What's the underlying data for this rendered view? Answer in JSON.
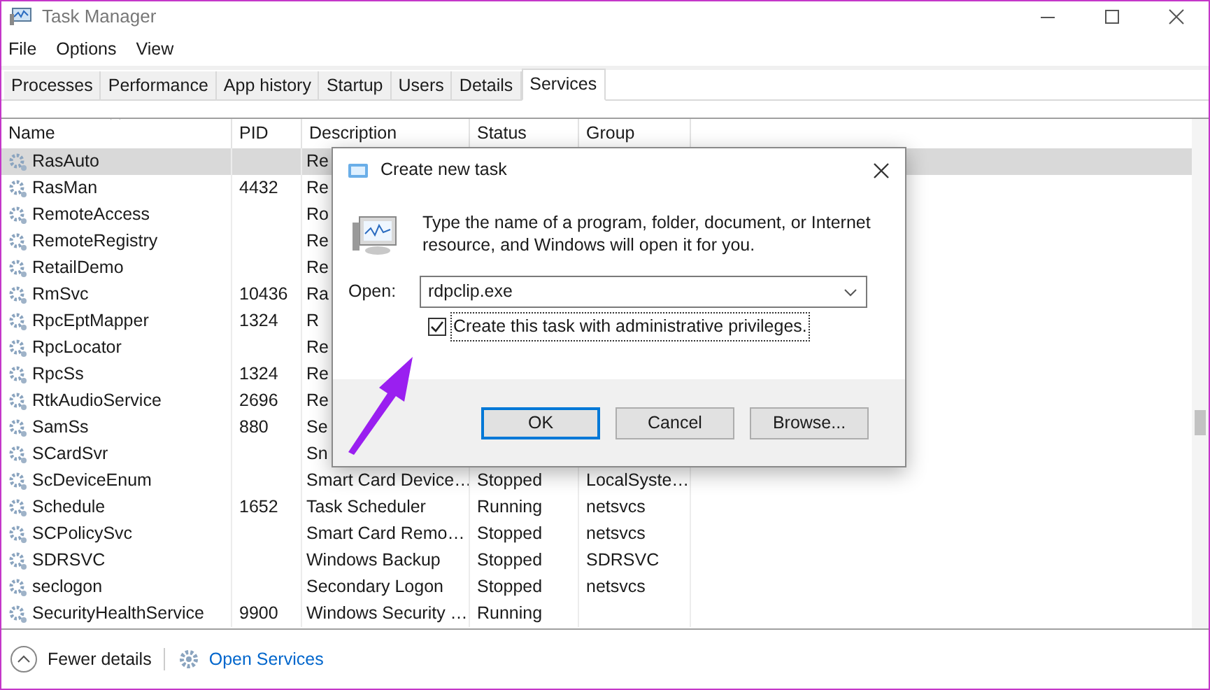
{
  "window": {
    "title": "Task Manager"
  },
  "menu": [
    "File",
    "Options",
    "View"
  ],
  "tabs": [
    {
      "label": "Processes",
      "selected": false
    },
    {
      "label": "Performance",
      "selected": false
    },
    {
      "label": "App history",
      "selected": false
    },
    {
      "label": "Startup",
      "selected": false
    },
    {
      "label": "Users",
      "selected": false
    },
    {
      "label": "Details",
      "selected": false
    },
    {
      "label": "Services",
      "selected": true
    }
  ],
  "table": {
    "columns": [
      "Name",
      "PID",
      "Description",
      "Status",
      "Group"
    ],
    "rows": [
      {
        "name": "RasAuto",
        "pid": "",
        "description": "Re",
        "status": "",
        "group": "",
        "selected": true
      },
      {
        "name": "RasMan",
        "pid": "4432",
        "description": "Re",
        "status": "",
        "group": "",
        "selected": false
      },
      {
        "name": "RemoteAccess",
        "pid": "",
        "description": "Ro",
        "status": "",
        "group": "",
        "selected": false
      },
      {
        "name": "RemoteRegistry",
        "pid": "",
        "description": "Re",
        "status": "",
        "group": "",
        "selected": false
      },
      {
        "name": "RetailDemo",
        "pid": "",
        "description": "Re",
        "status": "",
        "group": "",
        "selected": false
      },
      {
        "name": "RmSvc",
        "pid": "10436",
        "description": "Ra",
        "status": "",
        "group": "",
        "selected": false
      },
      {
        "name": "RpcEptMapper",
        "pid": "1324",
        "description": "R",
        "status": "",
        "group": "",
        "selected": false
      },
      {
        "name": "RpcLocator",
        "pid": "",
        "description": "Re",
        "status": "",
        "group": "",
        "selected": false
      },
      {
        "name": "RpcSs",
        "pid": "1324",
        "description": "Re",
        "status": "",
        "group": "",
        "selected": false
      },
      {
        "name": "RtkAudioService",
        "pid": "2696",
        "description": "Re",
        "status": "",
        "group": "",
        "selected": false
      },
      {
        "name": "SamSs",
        "pid": "880",
        "description": "Se",
        "status": "",
        "group": "",
        "selected": false
      },
      {
        "name": "SCardSvr",
        "pid": "",
        "description": "Sn",
        "status": "",
        "group": "",
        "selected": false
      },
      {
        "name": "ScDeviceEnum",
        "pid": "",
        "description": "Smart Card Device…",
        "status": "Stopped",
        "group": "LocalSyste…",
        "selected": false
      },
      {
        "name": "Schedule",
        "pid": "1652",
        "description": "Task Scheduler",
        "status": "Running",
        "group": "netsvcs",
        "selected": false
      },
      {
        "name": "SCPolicySvc",
        "pid": "",
        "description": "Smart Card Remo…",
        "status": "Stopped",
        "group": "netsvcs",
        "selected": false
      },
      {
        "name": "SDRSVC",
        "pid": "",
        "description": "Windows Backup",
        "status": "Stopped",
        "group": "SDRSVC",
        "selected": false
      },
      {
        "name": "seclogon",
        "pid": "",
        "description": "Secondary Logon",
        "status": "Stopped",
        "group": "netsvcs",
        "selected": false
      },
      {
        "name": "SecurityHealthService",
        "pid": "9900",
        "description": "Windows Security …",
        "status": "Running",
        "group": "",
        "selected": false
      }
    ]
  },
  "footer": {
    "fewer_details": "Fewer details",
    "open_services": "Open Services"
  },
  "dialog": {
    "title": "Create new task",
    "message": "Type the name of a program, folder, document, or Internet resource, and Windows will open it for you.",
    "open_label": "Open:",
    "open_value": "rdpclip.exe",
    "admin_checkbox": {
      "label": "Create this task with administrative privileges.",
      "checked": true
    },
    "buttons": [
      "OK",
      "Cancel",
      "Browse..."
    ]
  }
}
